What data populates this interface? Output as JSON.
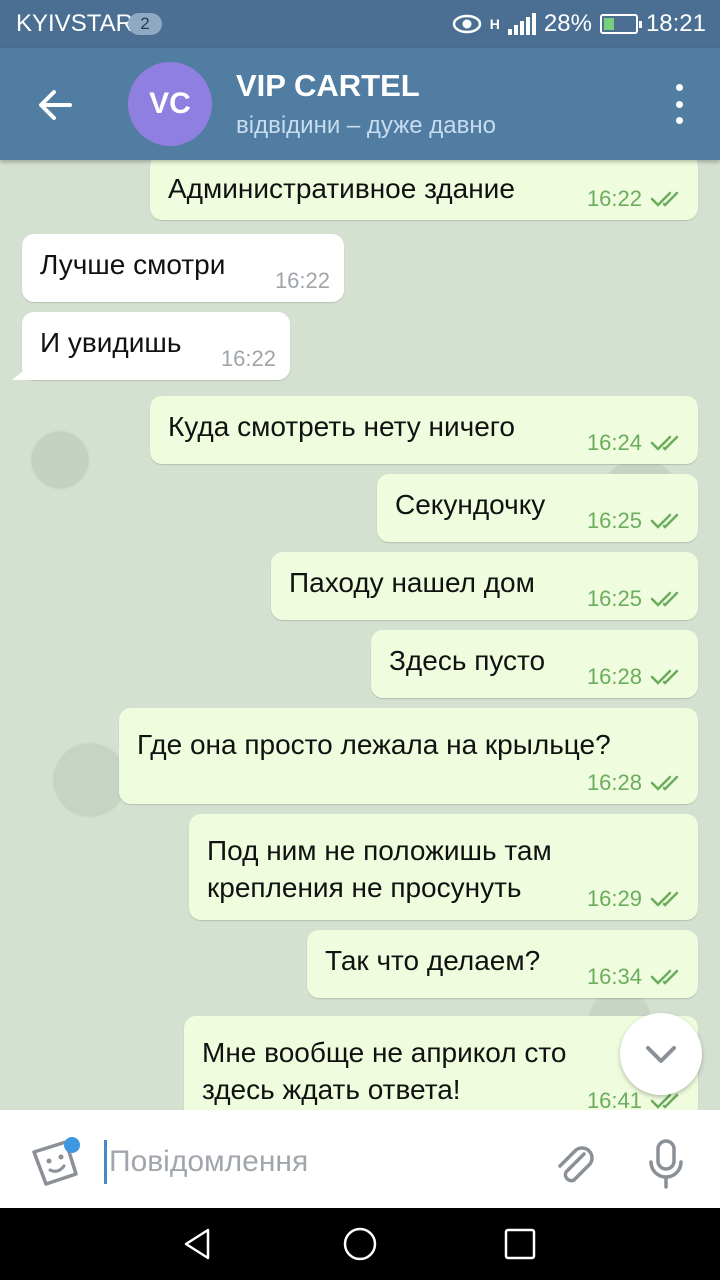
{
  "status_bar": {
    "carrier": "KYIVSTAR",
    "sim_badge": "2",
    "network": "H",
    "battery": "28%",
    "time": "18:21",
    "battery_level": 0.28
  },
  "header": {
    "avatar_initials": "VC",
    "avatar_color": "#8f7fe0",
    "title": "VIP CARTEL",
    "subtitle": "відвідини – дуже давно"
  },
  "messages": [
    {
      "direction": "out",
      "text": "Административное здание",
      "time": "16:22"
    },
    {
      "direction": "in",
      "text": "Лучше смотри",
      "time": "16:22"
    },
    {
      "direction": "in",
      "text": "И увидишь",
      "time": "16:22"
    },
    {
      "direction": "out",
      "text": "Куда смотреть нету ничего",
      "time": "16:24"
    },
    {
      "direction": "out",
      "text": "Секундочку",
      "time": "16:25"
    },
    {
      "direction": "out",
      "text": "Паходу нашел дом",
      "time": "16:25"
    },
    {
      "direction": "out",
      "text": "Здесь пусто",
      "time": "16:28"
    },
    {
      "direction": "out",
      "text": "Где она просто лежала на крыльце?",
      "time": "16:28"
    },
    {
      "direction": "out",
      "text": "Под ним не положишь там\nкрепления не просунуть",
      "time": "16:29"
    },
    {
      "direction": "out",
      "text": "Так что делаем?",
      "time": "16:34"
    },
    {
      "direction": "out",
      "text": "Мне вообще не априкол сто\nздесь ждать ответа!",
      "time": "16:41"
    }
  ],
  "composer": {
    "placeholder": "Повідомлення"
  },
  "colors": {
    "header": "#517da2",
    "outgoing_bubble": "#effdde",
    "incoming_bubble": "#ffffff",
    "check_color": "#6bac5d"
  }
}
